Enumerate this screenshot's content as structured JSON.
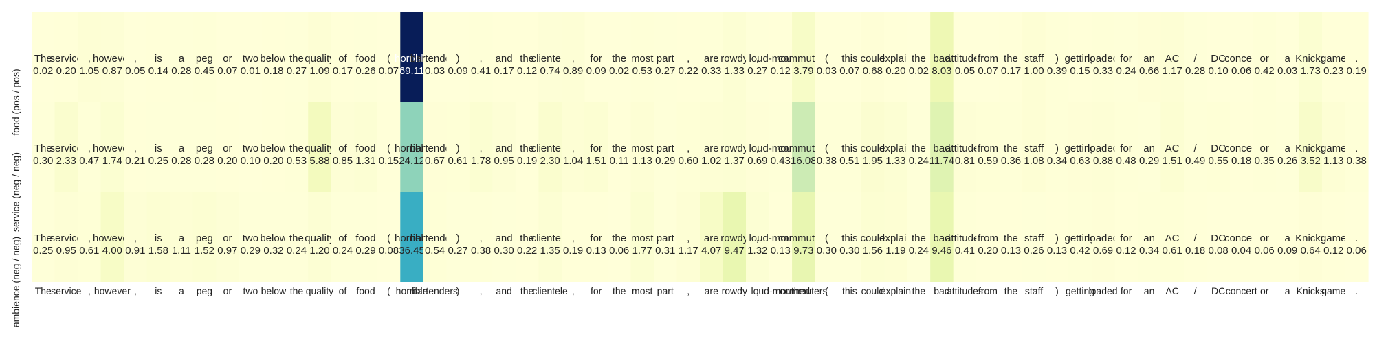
{
  "chart_data": {
    "type": "heatmap",
    "colormap": "YlGnBu",
    "vmin": 0,
    "vmax": 69.11,
    "title": "",
    "xlabel": "",
    "ylabel": "",
    "tokens": [
      "The",
      "service",
      ",",
      "however",
      ",",
      "is",
      "a",
      "peg",
      "or",
      "two",
      "below",
      "the",
      "quality",
      "of",
      "food",
      "(",
      "horrible",
      "bartenders",
      ")",
      ",",
      "and",
      "the",
      "clientele",
      ",",
      "for",
      "the",
      "most",
      "part",
      ",",
      "are",
      "rowdy",
      ",",
      "loud-mouthed",
      "commuters",
      "(",
      "this",
      "could",
      "explain",
      "the",
      "bad",
      "attitudes",
      "from",
      "the",
      "staff",
      ")",
      "getting",
      "loaded",
      "for",
      "an",
      "AC",
      "/",
      "DC",
      "concert",
      "or",
      "a",
      "Knicks",
      "game",
      "."
    ],
    "rows": [
      {
        "label": "food (pos / pos)",
        "values": [
          0.02,
          0.2,
          1.05,
          0.87,
          0.05,
          0.14,
          0.28,
          0.45,
          0.07,
          0.01,
          0.18,
          0.27,
          1.09,
          0.17,
          0.26,
          0.07,
          69.11,
          0.03,
          0.09,
          0.41,
          0.17,
          0.12,
          0.74,
          0.89,
          0.09,
          0.02,
          0.53,
          0.27,
          0.22,
          0.33,
          1.33,
          0.27,
          0.12,
          3.79,
          0.03,
          0.07,
          0.68,
          0.2,
          0.02,
          8.03,
          0.05,
          0.07,
          0.17,
          1.0,
          0.39,
          0.15,
          0.33,
          0.24,
          0.66,
          1.17,
          0.28,
          0.1,
          0.06,
          0.42,
          0.03,
          1.73,
          0.23,
          0.19
        ]
      },
      {
        "label": "service (neg / neg)",
        "values": [
          0.3,
          2.33,
          0.47,
          1.74,
          0.21,
          0.25,
          0.28,
          0.28,
          0.2,
          0.1,
          0.2,
          0.53,
          5.88,
          0.85,
          1.31,
          0.15,
          24.12,
          0.67,
          0.61,
          1.78,
          0.95,
          0.19,
          2.3,
          1.04,
          1.51,
          0.11,
          1.13,
          0.29,
          0.6,
          1.02,
          1.37,
          0.69,
          0.43,
          16.08,
          0.38,
          0.51,
          1.95,
          1.33,
          0.24,
          11.74,
          0.81,
          0.59,
          0.36,
          1.08,
          0.34,
          0.63,
          0.88,
          0.48,
          0.29,
          1.51,
          0.49,
          0.55,
          0.18,
          0.35,
          0.26,
          3.52,
          1.13,
          0.38
        ]
      },
      {
        "label": "ambience (neg / neg)",
        "values": [
          0.25,
          0.95,
          0.61,
          4.0,
          0.91,
          1.58,
          1.11,
          1.52,
          0.97,
          0.29,
          0.32,
          0.24,
          1.2,
          0.24,
          0.29,
          0.08,
          36.45,
          0.54,
          0.27,
          0.38,
          0.3,
          0.22,
          1.35,
          0.19,
          0.13,
          0.06,
          1.77,
          0.31,
          1.17,
          4.07,
          9.47,
          1.32,
          0.13,
          9.73,
          0.3,
          0.3,
          1.56,
          1.19,
          0.24,
          9.46,
          0.41,
          0.2,
          0.13,
          0.26,
          0.13,
          0.42,
          0.69,
          0.12,
          0.34,
          0.61,
          0.18,
          0.08,
          0.04,
          0.06,
          0.09,
          0.64,
          0.12,
          0.06
        ]
      }
    ]
  }
}
